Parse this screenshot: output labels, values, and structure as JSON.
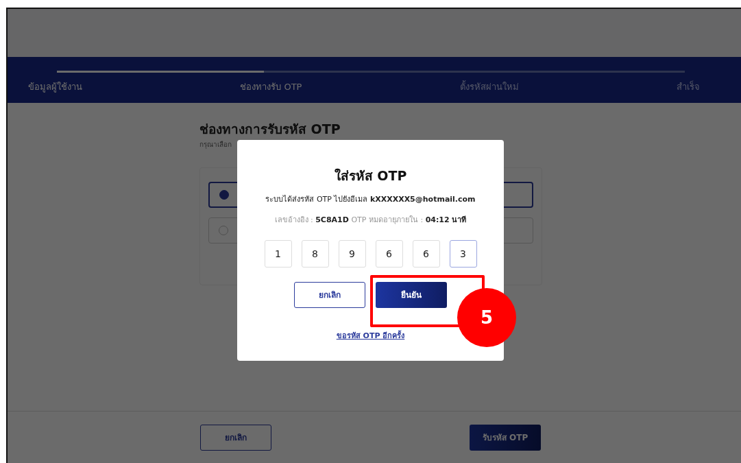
{
  "stepper": {
    "progress": {
      "level": 0.33
    },
    "steps": [
      {
        "label": "ข้อมูลผู้ใช้งาน",
        "reached": true
      },
      {
        "label": "ช่องทางรับ OTP",
        "reached": true
      },
      {
        "label": "ตั้งรหัสผ่านใหม่",
        "reached": false
      },
      {
        "label": "สำเร็จ",
        "reached": false
      }
    ]
  },
  "section": {
    "title": "ช่องทางการรับรหัส OTP",
    "subtitle": "กรุณาเลือก",
    "options": [
      {
        "selected": true
      },
      {
        "selected": false
      }
    ]
  },
  "footer": {
    "cancel": "ยกเลิก",
    "submit": "รับรหัส OTP"
  },
  "dialog": {
    "title": "ใส่รหัส OTP",
    "sent_text": "ระบบได้ส่งรหัส OTP ไปยังอีเมล",
    "email": "kXXXXXX5@hotmail.com",
    "ref_label": "เลขอ้างอิง :",
    "ref_code": "5C8A1D",
    "expire_label": "OTP หมดอายุภายใน :",
    "expire_time": "04:12 นาที",
    "digits": [
      {
        "value": "1",
        "focused": false
      },
      {
        "value": "8",
        "focused": false
      },
      {
        "value": "9",
        "focused": false
      },
      {
        "value": "6",
        "focused": false
      },
      {
        "value": "6",
        "focused": false
      },
      {
        "value": "3",
        "focused": true
      }
    ],
    "cancel": "ยกเลิก",
    "confirm": "ยืนยัน",
    "resend": "ขอรหัส OTP อีกครั้ง"
  },
  "annotation": {
    "number": "5"
  }
}
